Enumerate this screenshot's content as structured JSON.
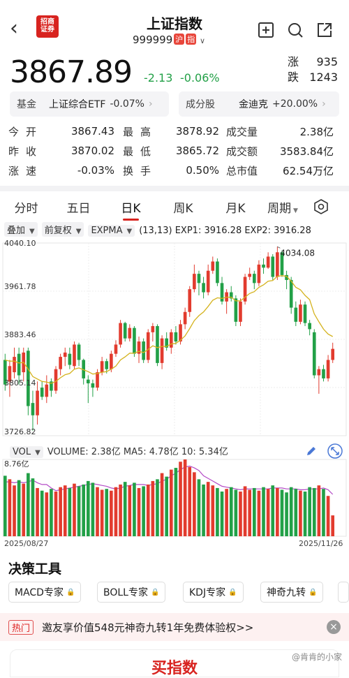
{
  "header": {
    "title": "上证指数",
    "code": "999999",
    "tag1": "沪",
    "tag2": "指",
    "logo_line1": "招商",
    "logo_line2": "证券"
  },
  "quote": {
    "price": "3867.89",
    "change": "-2.13",
    "change_pct": "-0.06%",
    "up_label": "涨",
    "up_count": "935",
    "down_label": "跌",
    "down_count": "1243"
  },
  "fund": {
    "label": "基金",
    "name": "上证综合ETF",
    "pct": "-0.07%"
  },
  "component": {
    "label": "成分股",
    "name": "金迪克",
    "pct": "+20.00%"
  },
  "stats": [
    {
      "l1": "今开",
      "v1": "3867.43",
      "l2": "最高",
      "v2": "3878.92",
      "l3": "成交量",
      "v3": "2.38亿"
    },
    {
      "l1": "昨收",
      "v1": "3870.02",
      "l2": "最低",
      "v2": "3865.72",
      "l3": "成交额",
      "v3": "3583.84亿"
    },
    {
      "l1": "涨速",
      "v1": "-0.03%",
      "l2": "换手",
      "v2": "0.50%",
      "l3": "总市值",
      "v3": "62.54万亿"
    }
  ],
  "tabs": [
    "分时",
    "五日",
    "日K",
    "周K",
    "月K",
    "周期"
  ],
  "controls": {
    "overlay": "叠加",
    "adjust": "前复权",
    "indicator": "EXPMA",
    "readout": "(13,13) EXP1: 3916.28 EXP2: 3916.28"
  },
  "axis": {
    "y_labels": [
      "4040.10",
      "3961.78",
      "3883.46",
      "3805.14",
      "3726.82"
    ],
    "max_label": "4034.08",
    "vol_max": "8.76亿",
    "date_start": "2025/08/27",
    "date_end": "2025/11/26"
  },
  "volume": {
    "label": "VOL",
    "readout": "VOLUME: 2.38亿  MA5: 4.78亿  10: 5.34亿"
  },
  "tools": {
    "title": "决策工具",
    "items": [
      "MACD专家",
      "BOLL专家",
      "KDJ专家",
      "神奇九转"
    ]
  },
  "promo": {
    "tag": "热门",
    "text": "邀友享价值548元神奇九转1年免费体验权>>"
  },
  "bottom": {
    "title": "买指数",
    "watermark": "@肯肯的小家"
  },
  "colors": {
    "up": "#e23b2e",
    "down": "#22a047",
    "ma1": "#d4b21c",
    "ma2": "#b44cc7",
    "accent": "#d8231f"
  },
  "chart_data": {
    "type": "candlestick",
    "ylim": [
      3726.82,
      4040.1
    ],
    "x_range": [
      "2025/08/27",
      "2025/11/26"
    ],
    "candles": [
      {
        "o": 3850,
        "c": 3810,
        "h": 3860,
        "l": 3800
      },
      {
        "o": 3815,
        "c": 3840,
        "h": 3850,
        "l": 3790
      },
      {
        "o": 3830,
        "c": 3855,
        "h": 3870,
        "l": 3820
      },
      {
        "o": 3860,
        "c": 3825,
        "h": 3870,
        "l": 3810
      },
      {
        "o": 3830,
        "c": 3862,
        "h": 3870,
        "l": 3815
      },
      {
        "o": 3865,
        "c": 3775,
        "h": 3870,
        "l": 3760
      },
      {
        "o": 3780,
        "c": 3760,
        "h": 3800,
        "l": 3735
      },
      {
        "o": 3760,
        "c": 3800,
        "h": 3815,
        "l": 3745
      },
      {
        "o": 3805,
        "c": 3790,
        "h": 3815,
        "l": 3785
      },
      {
        "o": 3790,
        "c": 3810,
        "h": 3825,
        "l": 3780
      },
      {
        "o": 3815,
        "c": 3800,
        "h": 3820,
        "l": 3790
      },
      {
        "o": 3800,
        "c": 3835,
        "h": 3840,
        "l": 3795
      },
      {
        "o": 3835,
        "c": 3855,
        "h": 3860,
        "l": 3825
      },
      {
        "o": 3855,
        "c": 3862,
        "h": 3870,
        "l": 3840
      },
      {
        "o": 3860,
        "c": 3842,
        "h": 3870,
        "l": 3835
      },
      {
        "o": 3840,
        "c": 3875,
        "h": 3880,
        "l": 3835
      },
      {
        "o": 3875,
        "c": 3850,
        "h": 3878,
        "l": 3840
      },
      {
        "o": 3850,
        "c": 3820,
        "h": 3852,
        "l": 3810
      },
      {
        "o": 3818,
        "c": 3812,
        "h": 3825,
        "l": 3780
      },
      {
        "o": 3812,
        "c": 3805,
        "h": 3818,
        "l": 3790
      },
      {
        "o": 3805,
        "c": 3830,
        "h": 3835,
        "l": 3800
      },
      {
        "o": 3830,
        "c": 3848,
        "h": 3855,
        "l": 3825
      },
      {
        "o": 3848,
        "c": 3835,
        "h": 3852,
        "l": 3828
      },
      {
        "o": 3835,
        "c": 3860,
        "h": 3865,
        "l": 3830
      },
      {
        "o": 3860,
        "c": 3875,
        "h": 3882,
        "l": 3855
      },
      {
        "o": 3875,
        "c": 3910,
        "h": 3915,
        "l": 3870
      },
      {
        "o": 3910,
        "c": 3885,
        "h": 3912,
        "l": 3880
      },
      {
        "o": 3885,
        "c": 3902,
        "h": 3908,
        "l": 3880
      },
      {
        "o": 3902,
        "c": 3860,
        "h": 3905,
        "l": 3855
      },
      {
        "o": 3860,
        "c": 3880,
        "h": 3888,
        "l": 3845
      },
      {
        "o": 3880,
        "c": 3850,
        "h": 3885,
        "l": 3845
      },
      {
        "o": 3850,
        "c": 3895,
        "h": 3900,
        "l": 3845
      },
      {
        "o": 3895,
        "c": 3905,
        "h": 3910,
        "l": 3880
      },
      {
        "o": 3905,
        "c": 3845,
        "h": 3908,
        "l": 3840
      },
      {
        "o": 3845,
        "c": 3885,
        "h": 3890,
        "l": 3835
      },
      {
        "o": 3885,
        "c": 3870,
        "h": 3895,
        "l": 3865
      },
      {
        "o": 3870,
        "c": 3895,
        "h": 3900,
        "l": 3860
      },
      {
        "o": 3895,
        "c": 3880,
        "h": 3905,
        "l": 3875
      },
      {
        "o": 3880,
        "c": 3908,
        "h": 3915,
        "l": 3875
      },
      {
        "o": 3908,
        "c": 3928,
        "h": 3935,
        "l": 3900
      },
      {
        "o": 3928,
        "c": 3965,
        "h": 3970,
        "l": 3920
      },
      {
        "o": 3965,
        "c": 3990,
        "h": 4005,
        "l": 3960
      },
      {
        "o": 3990,
        "c": 3975,
        "h": 3995,
        "l": 3955
      },
      {
        "o": 3975,
        "c": 3960,
        "h": 3985,
        "l": 3950
      },
      {
        "o": 3960,
        "c": 3995,
        "h": 4005,
        "l": 3955
      },
      {
        "o": 3995,
        "c": 4010,
        "h": 4018,
        "l": 3990
      },
      {
        "o": 4010,
        "c": 3975,
        "h": 4015,
        "l": 3970
      },
      {
        "o": 3975,
        "c": 3945,
        "h": 3985,
        "l": 3940
      },
      {
        "o": 3945,
        "c": 3960,
        "h": 3965,
        "l": 3925
      },
      {
        "o": 3960,
        "c": 3950,
        "h": 3970,
        "l": 3945
      },
      {
        "o": 3950,
        "c": 3912,
        "h": 3955,
        "l": 3905
      },
      {
        "o": 3912,
        "c": 3945,
        "h": 3950,
        "l": 3905
      },
      {
        "o": 3945,
        "c": 3985,
        "h": 3990,
        "l": 3940
      },
      {
        "o": 3985,
        "c": 3990,
        "h": 4000,
        "l": 3980
      },
      {
        "o": 3990,
        "c": 3975,
        "h": 3995,
        "l": 3965
      },
      {
        "o": 3975,
        "c": 4005,
        "h": 4012,
        "l": 3970
      },
      {
        "o": 4005,
        "c": 4000,
        "h": 4015,
        "l": 3990
      },
      {
        "o": 4000,
        "c": 4018,
        "h": 4025,
        "l": 3998
      },
      {
        "o": 4018,
        "c": 3985,
        "h": 4022,
        "l": 3980
      },
      {
        "o": 3985,
        "c": 4025,
        "h": 4034.08,
        "l": 3980
      },
      {
        "o": 4025,
        "c": 3988,
        "h": 4028,
        "l": 3985
      },
      {
        "o": 3988,
        "c": 3980,
        "h": 3995,
        "l": 3965
      },
      {
        "o": 3980,
        "c": 3935,
        "h": 3985,
        "l": 3925
      },
      {
        "o": 3935,
        "c": 3912,
        "h": 3945,
        "l": 3905
      },
      {
        "o": 3912,
        "c": 3940,
        "h": 3948,
        "l": 3908
      },
      {
        "o": 3940,
        "c": 3910,
        "h": 3945,
        "l": 3905
      },
      {
        "o": 3910,
        "c": 3900,
        "h": 3915,
        "l": 3890
      },
      {
        "o": 3895,
        "c": 3825,
        "h": 3900,
        "l": 3820
      },
      {
        "o": 3825,
        "c": 3835,
        "h": 3840,
        "l": 3795
      },
      {
        "o": 3835,
        "c": 3820,
        "h": 3842,
        "l": 3815
      },
      {
        "o": 3820,
        "c": 3850,
        "h": 3858,
        "l": 3815
      },
      {
        "o": 3850,
        "c": 3868,
        "h": 3878,
        "l": 3845
      }
    ],
    "expma": [
      3850,
      3848,
      3848,
      3845,
      3846,
      3835,
      3823,
      3819,
      3815,
      3814,
      3812,
      3815,
      3821,
      3826,
      3828,
      3835,
      3837,
      3834,
      3831,
      3827,
      3828,
      3830,
      3831,
      3835,
      3840,
      3850,
      3855,
      3861,
      3861,
      3864,
      3862,
      3867,
      3873,
      3870,
      3872,
      3872,
      3876,
      3877,
      3882,
      3889,
      3901,
      3914,
      3922,
      3928,
      3937,
      3947,
      3951,
      3950,
      3952,
      3952,
      3946,
      3946,
      3952,
      3958,
      3961,
      3968,
      3972,
      3978,
      3979,
      3986,
      3987,
      3986,
      3978,
      3968,
      3964,
      3955,
      3948,
      3925,
      3912,
      3900,
      3892,
      3888
    ],
    "volume": [
      6.9,
      6.5,
      5.8,
      6.4,
      6.0,
      7.2,
      6.6,
      5.5,
      5.2,
      5.0,
      5.4,
      5.1,
      5.6,
      5.8,
      5.5,
      6.0,
      5.7,
      5.9,
      6.3,
      6.1,
      5.6,
      5.3,
      5.4,
      5.2,
      5.6,
      5.9,
      6.2,
      5.8,
      6.1,
      5.5,
      5.7,
      5.9,
      6.3,
      6.5,
      7.2,
      6.8,
      7.6,
      7.8,
      8.5,
      8.76,
      7.9,
      7.3,
      6.5,
      5.9,
      6.2,
      5.8,
      5.5,
      5.1,
      5.4,
      5.6,
      5.3,
      5.1,
      5.7,
      5.3,
      5.5,
      5.2,
      5.6,
      5.4,
      5.8,
      5.5,
      5.3,
      5.0,
      5.6,
      5.4,
      5.2,
      5.1,
      5.6,
      5.5,
      5.8,
      5.4,
      4.6,
      2.38
    ],
    "vol_ma5": [
      6.2,
      6.2,
      6.1,
      6.2,
      6.1,
      6.2,
      6.4,
      6.1,
      5.9,
      5.9,
      5.5,
      5.2,
      5.3,
      5.4,
      5.5,
      5.6,
      5.7,
      5.8,
      5.9,
      6.0,
      5.9,
      5.8,
      5.7,
      5.5,
      5.4,
      5.5,
      5.7,
      5.8,
      5.9,
      5.9,
      5.9,
      5.8,
      5.9,
      6.0,
      6.3,
      6.5,
      6.9,
      7.2,
      7.6,
      7.9,
      8.0,
      7.8,
      7.5,
      6.9,
      6.6,
      6.3,
      6.0,
      5.7,
      5.6,
      5.5,
      5.4,
      5.3,
      5.4,
      5.4,
      5.4,
      5.4,
      5.4,
      5.4,
      5.5,
      5.5,
      5.5,
      5.4,
      5.4,
      5.4,
      5.3,
      5.3,
      5.4,
      5.4,
      5.4,
      5.5,
      5.3,
      4.78
    ]
  }
}
